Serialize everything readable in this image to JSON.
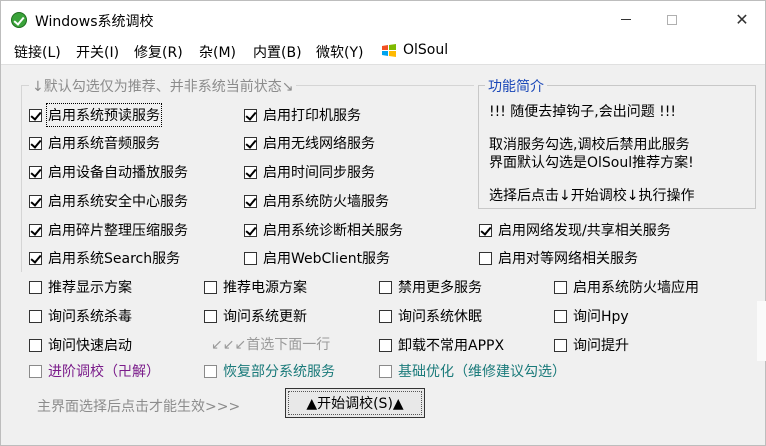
{
  "window": {
    "title": "Windows系统调校",
    "controls": {
      "minimize": "minimize",
      "maximize": "maximize",
      "close": "✕"
    }
  },
  "menu": {
    "items": [
      "链接(L)",
      "开关(I)",
      "修复(R)",
      "杂(M)",
      "内置(B)",
      "微软(Y)"
    ],
    "brand": "OlSoul"
  },
  "group": {
    "legend": "↓默认勾选仅为推荐、并非系统当前状态↘"
  },
  "info": {
    "title": "功能简介",
    "lines": [
      "!!! 随便去掉钩子,会出问题 !!!",
      "取消服务勾选,调校后禁用此服务",
      "界面默认勾选是OlSoul推荐方案!",
      "选择后点击↓开始调校↓执行操作"
    ]
  },
  "checkboxes": {
    "col1": [
      {
        "label": "启用系统预读服务",
        "checked": true
      },
      {
        "label": "启用系统音频服务",
        "checked": true
      },
      {
        "label": "启用设备自动播放服务",
        "checked": true
      },
      {
        "label": "启用系统安全中心服务",
        "checked": true
      },
      {
        "label": "启用碎片整理压缩服务",
        "checked": true
      },
      {
        "label": "启用系统Search服务",
        "checked": true
      }
    ],
    "col2": [
      {
        "label": "启用打印机服务",
        "checked": true
      },
      {
        "label": "启用无线网络服务",
        "checked": true
      },
      {
        "label": "启用时间同步服务",
        "checked": true
      },
      {
        "label": "启用系统防火墙服务",
        "checked": true
      },
      {
        "label": "启用系统诊断相关服务",
        "checked": true
      },
      {
        "label": "启用WebClient服务",
        "checked": false
      }
    ],
    "col3": [
      {
        "label": "启用网络发现/共享相关服务",
        "checked": true
      },
      {
        "label": "启用对等网络相关服务",
        "checked": false
      }
    ],
    "row_a": [
      "推荐显示方案",
      "推荐电源方案",
      "禁用更多服务",
      "启用系统防火墙应用"
    ],
    "row_b": [
      "询问系统杀毒",
      "询问系统更新",
      "询问系统休眠",
      "询问Hpy"
    ],
    "row_c": [
      "询问快速启动",
      "卸载不常用APPX",
      "询问提升"
    ],
    "hint": "↙↙↙首选下面一行",
    "row_d": [
      "进阶调校（卍解）",
      "恢复部分系统服务",
      "基础优化（维修建议勾选）"
    ]
  },
  "footer": {
    "text": "主界面选择后点击才能生效>>>",
    "start_button": "▲开始调校(S)▲"
  },
  "colors": {
    "info_title": "#1a47b8",
    "advanced": "#7a1b8a",
    "restore": "#1a7a7a",
    "basic": "#1a7a7a"
  }
}
